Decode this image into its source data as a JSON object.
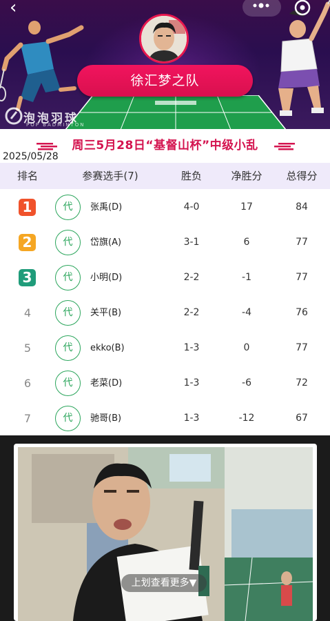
{
  "header": {
    "team_name": "徐汇梦之队",
    "logo_text_cn": "泡泡羽球",
    "logo_text_en": "POP BADMINTON",
    "icons": [
      "back-icon",
      "more-icon",
      "close-icon"
    ]
  },
  "event": {
    "title": "周三5月28日“基督山杯”中级小乱",
    "date": "2025/05/28"
  },
  "table": {
    "columns": [
      "排名",
      "参赛选手(7)",
      "胜负",
      "净胜分",
      "总得分"
    ],
    "rows": [
      {
        "rank": "1",
        "tag": "代",
        "name": "张禹(D)",
        "record": "4-0",
        "net": "17",
        "total": "84"
      },
      {
        "rank": "2",
        "tag": "代",
        "name": "岱旗(A)",
        "record": "3-1",
        "net": "6",
        "total": "77"
      },
      {
        "rank": "3",
        "tag": "代",
        "name": "小明(D)",
        "record": "2-2",
        "net": "-1",
        "total": "77"
      },
      {
        "rank": "4",
        "tag": "代",
        "name": "关平(B)",
        "record": "2-2",
        "net": "-4",
        "total": "76"
      },
      {
        "rank": "5",
        "tag": "代",
        "name": "ekko(B)",
        "record": "1-3",
        "net": "0",
        "total": "77"
      },
      {
        "rank": "6",
        "tag": "代",
        "name": "老菜(D)",
        "record": "1-3",
        "net": "-6",
        "total": "72"
      },
      {
        "rank": "7",
        "tag": "代",
        "name": "驰哥(B)",
        "record": "1-3",
        "net": "-12",
        "total": "67"
      }
    ]
  },
  "colors": {
    "accent": "#d4134f",
    "medal_gold": "#f5a623",
    "medal_silver": "#f39c12",
    "medal_first": "#f0522b",
    "medal_third": "#1f9c7a",
    "tag_green": "#2aa55b",
    "header_bg": "#efeafa"
  },
  "video": {
    "swipe_hint": "上划查看更多▼"
  }
}
